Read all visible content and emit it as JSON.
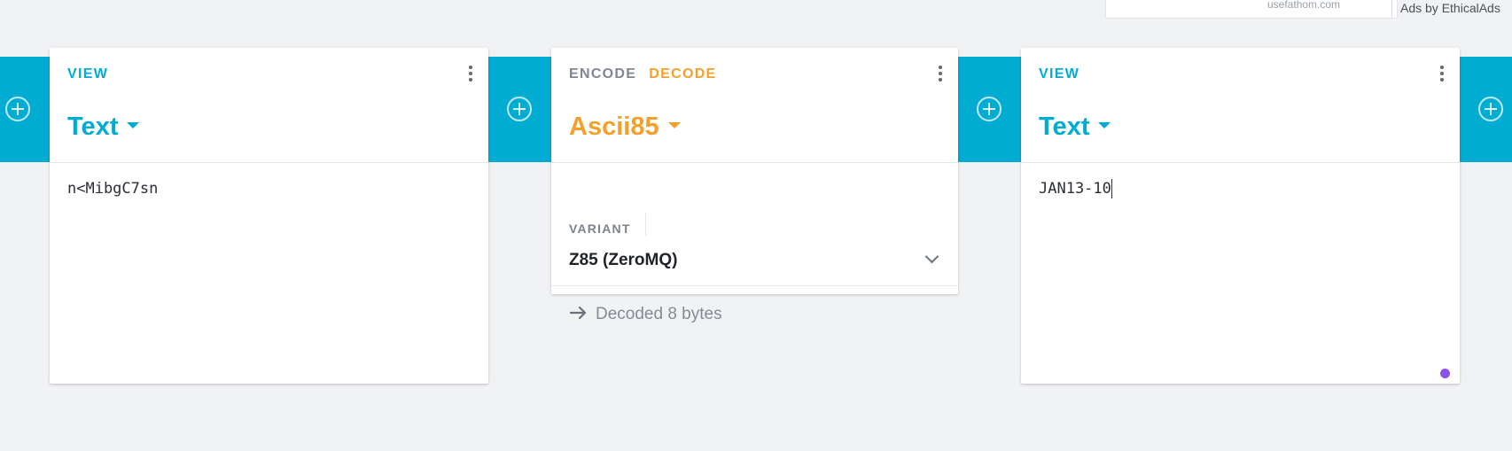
{
  "ad": {
    "source_text": "usefathom.com",
    "attribution": "Ads by EthicalAds"
  },
  "colors": {
    "accent_blue": "#00acd2",
    "accent_orange": "#f5a02a",
    "status_dot": "#8c51e8"
  },
  "cards": [
    {
      "overline": "VIEW",
      "format": "Text",
      "content": "n<MibgC7sn"
    },
    {
      "overline_encode": "ENCODE",
      "overline_decode": "DECODE",
      "format": "Ascii85",
      "variant_label": "VARIANT",
      "variant_value": "Z85 (ZeroMQ)",
      "status": "Decoded 8 bytes"
    },
    {
      "overline": "VIEW",
      "format": "Text",
      "content": "JAN13-10"
    }
  ]
}
